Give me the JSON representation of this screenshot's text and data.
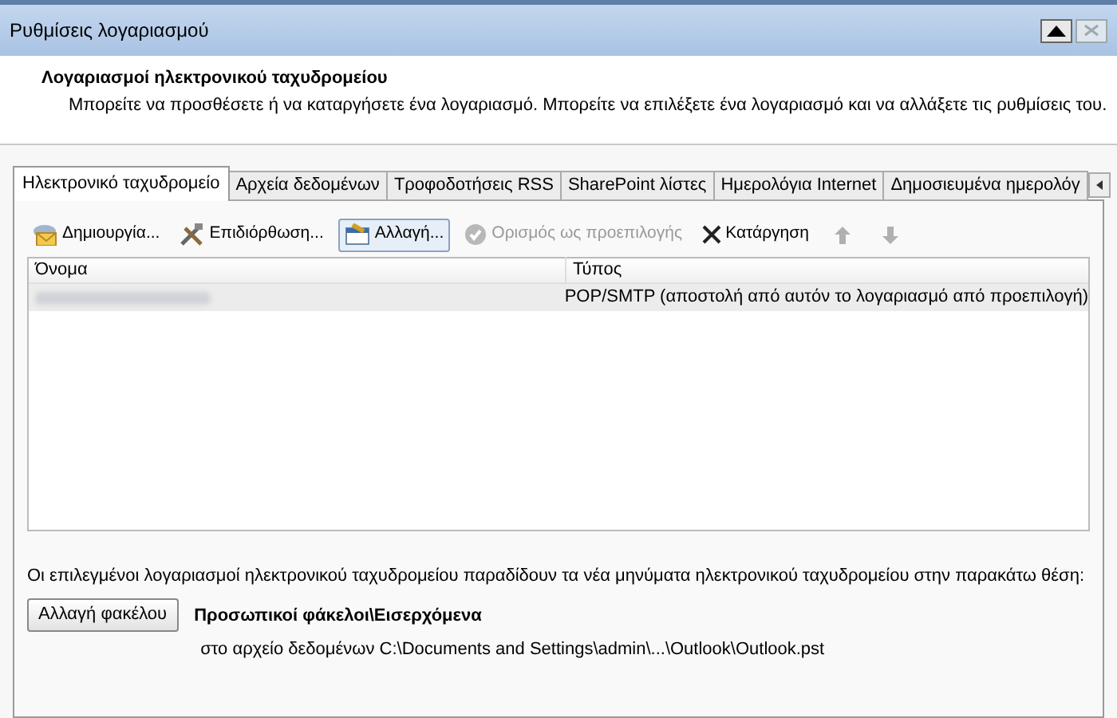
{
  "window": {
    "title": "Ρυθμίσεις λογαριασμού"
  },
  "header": {
    "title": "Λογαριασμοί ηλεκτρονικού ταχυδρομείου",
    "description": "Μπορείτε να προσθέσετε ή να καταργήσετε ένα λογαριασμό. Μπορείτε να επιλέξετε ένα λογαριασμό και να αλλάξετε τις ρυθμίσεις του."
  },
  "tabs": [
    {
      "label": "Ηλεκτρονικό ταχυδρομείο",
      "selected": true
    },
    {
      "label": "Αρχεία δεδομένων",
      "selected": false
    },
    {
      "label": "Τροφοδοτήσεις RSS",
      "selected": false
    },
    {
      "label": "SharePoint λίστες",
      "selected": false
    },
    {
      "label": "Ημερολόγια Internet",
      "selected": false
    },
    {
      "label": "Δημοσιευμένα ημερολόγ",
      "selected": false
    }
  ],
  "toolbar": [
    {
      "kind": "new",
      "label": "Δημιουργία...",
      "disabled": false,
      "selected": false
    },
    {
      "kind": "repair",
      "label": "Επιδιόρθωση...",
      "disabled": false,
      "selected": false
    },
    {
      "kind": "change",
      "label": "Αλλαγή...",
      "disabled": false,
      "selected": true
    },
    {
      "kind": "default",
      "label": "Ορισμός ως προεπιλογής",
      "disabled": true,
      "selected": false
    },
    {
      "kind": "remove",
      "label": "Κατάργηση",
      "disabled": false,
      "selected": false
    },
    {
      "kind": "up",
      "disabled": true,
      "selected": false
    },
    {
      "kind": "down",
      "disabled": true,
      "selected": false
    }
  ],
  "table": {
    "columns": [
      "Όνομα",
      "Τύπος"
    ],
    "rows": [
      {
        "type": "POP/SMTP (αποστολή από αυτόν το λογαριασμό από προεπιλογή)",
        "selected": true
      }
    ]
  },
  "delivery": {
    "text": "Οι επιλεγμένοι λογαριασμοί ηλεκτρονικού ταχυδρομείου παραδίδουν τα νέα μηνύματα ηλεκτρονικού ταχυδρομείου στην παρακάτω θέση:",
    "button": "Αλλαγή φακέλου",
    "folder": "Προσωπικοί φάκελοι\\Εισερχόμενα",
    "path": "στο αρχείο δεδομένων C:\\Documents and Settings\\admin\\...\\Outlook\\Outlook.pst"
  }
}
